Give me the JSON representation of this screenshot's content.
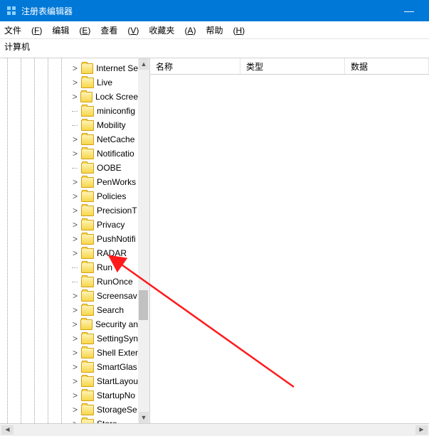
{
  "window": {
    "title": "注册表编辑器"
  },
  "menu": {
    "file": {
      "label": "文件",
      "hotkey": "F"
    },
    "edit": {
      "label": "编辑",
      "hotkey": "E"
    },
    "view": {
      "label": "查看",
      "hotkey": "V"
    },
    "fav": {
      "label": "收藏夹",
      "hotkey": "A"
    },
    "help": {
      "label": "帮助",
      "hotkey": "H"
    }
  },
  "address": "计算机",
  "columns": {
    "name": "名称",
    "type": "类型",
    "data": "数据"
  },
  "tree": [
    {
      "label": "Internet Se",
      "exp": ">"
    },
    {
      "label": "Live",
      "exp": ">"
    },
    {
      "label": "Lock Scree",
      "exp": ">"
    },
    {
      "label": "miniconfig",
      "exp": ""
    },
    {
      "label": "Mobility",
      "exp": ""
    },
    {
      "label": "NetCache",
      "exp": ">"
    },
    {
      "label": "Notificatio",
      "exp": ">"
    },
    {
      "label": "OOBE",
      "exp": ""
    },
    {
      "label": "PenWorks",
      "exp": ">"
    },
    {
      "label": "Policies",
      "exp": ">"
    },
    {
      "label": "PrecisionT",
      "exp": ">"
    },
    {
      "label": "Privacy",
      "exp": ">"
    },
    {
      "label": "PushNotifi",
      "exp": ">"
    },
    {
      "label": "RADAR",
      "exp": ">"
    },
    {
      "label": "Run",
      "exp": ""
    },
    {
      "label": "RunOnce",
      "exp": ""
    },
    {
      "label": "Screensav",
      "exp": ">"
    },
    {
      "label": "Search",
      "exp": ">"
    },
    {
      "label": "Security an",
      "exp": ">"
    },
    {
      "label": "SettingSyn",
      "exp": ">"
    },
    {
      "label": "Shell Exter",
      "exp": ">"
    },
    {
      "label": "SmartGlas",
      "exp": ">"
    },
    {
      "label": "StartLayou",
      "exp": ">"
    },
    {
      "label": "StartupNo",
      "exp": ">"
    },
    {
      "label": "StorageSe",
      "exp": ">"
    },
    {
      "label": "Store",
      "exp": ">"
    }
  ]
}
